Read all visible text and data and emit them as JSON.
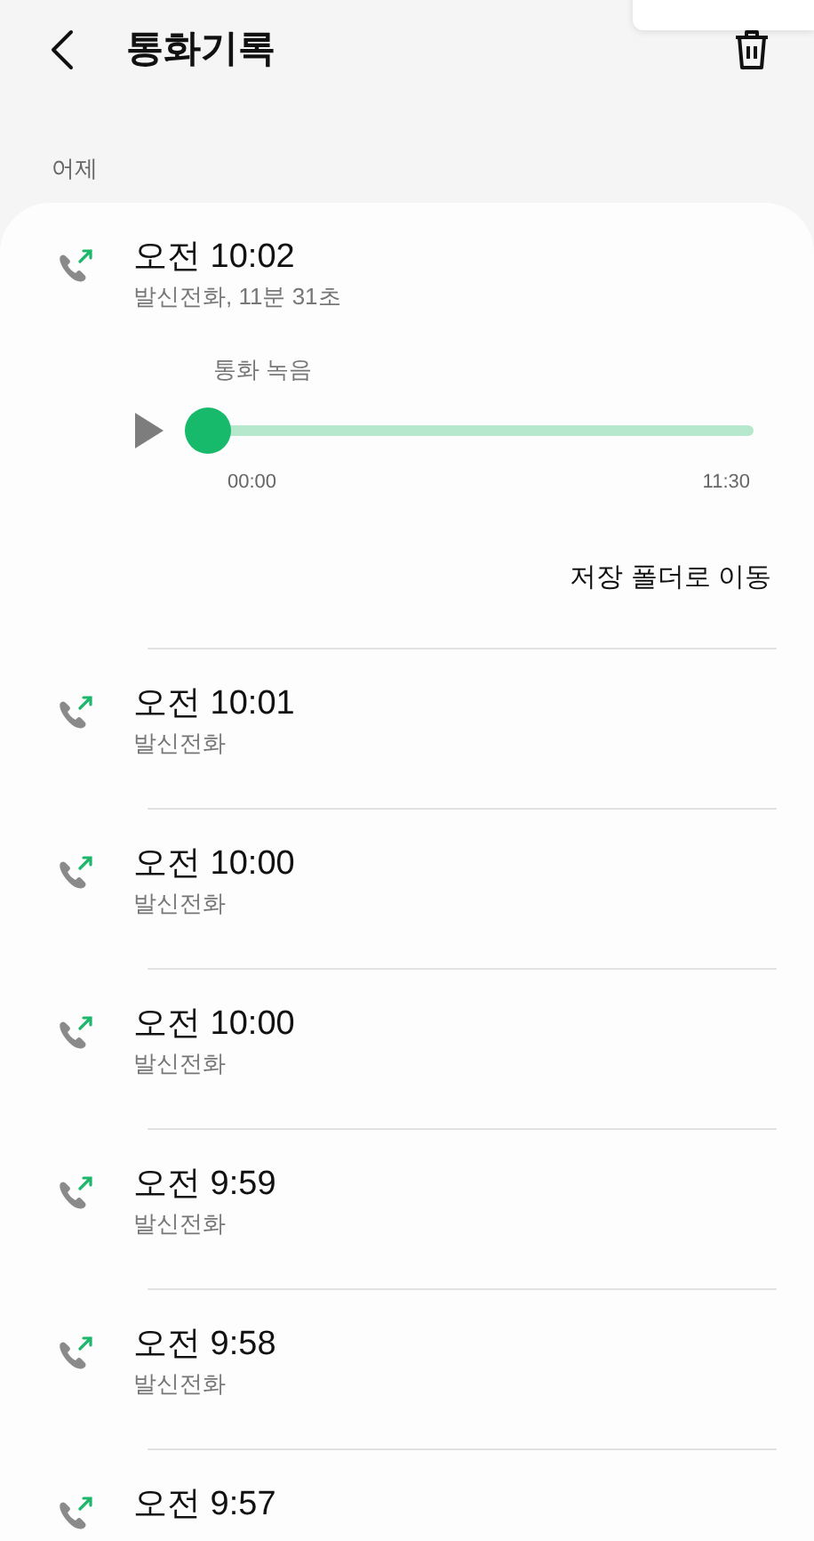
{
  "header": {
    "title": "통화기록"
  },
  "section": {
    "label": "어제"
  },
  "calls": [
    {
      "time": "오전 10:02",
      "detail": "발신전화, 11분 31초",
      "expanded": true,
      "recording": {
        "label": "통화 녹음",
        "level": 0,
        "start": "00:00",
        "end": "11:30",
        "action": "저장 폴더로 이동"
      }
    },
    {
      "time": "오전 10:01",
      "detail": "발신전화",
      "expanded": false
    },
    {
      "time": "오전 10:00",
      "detail": "발신전화",
      "expanded": false
    },
    {
      "time": "오전 10:00",
      "detail": "발신전화",
      "expanded": false
    },
    {
      "time": "오전 9:59",
      "detail": "발신전화",
      "expanded": false
    },
    {
      "time": "오전 9:58",
      "detail": "발신전화",
      "expanded": false
    },
    {
      "time": "오전 9:57",
      "expanded": false
    }
  ]
}
